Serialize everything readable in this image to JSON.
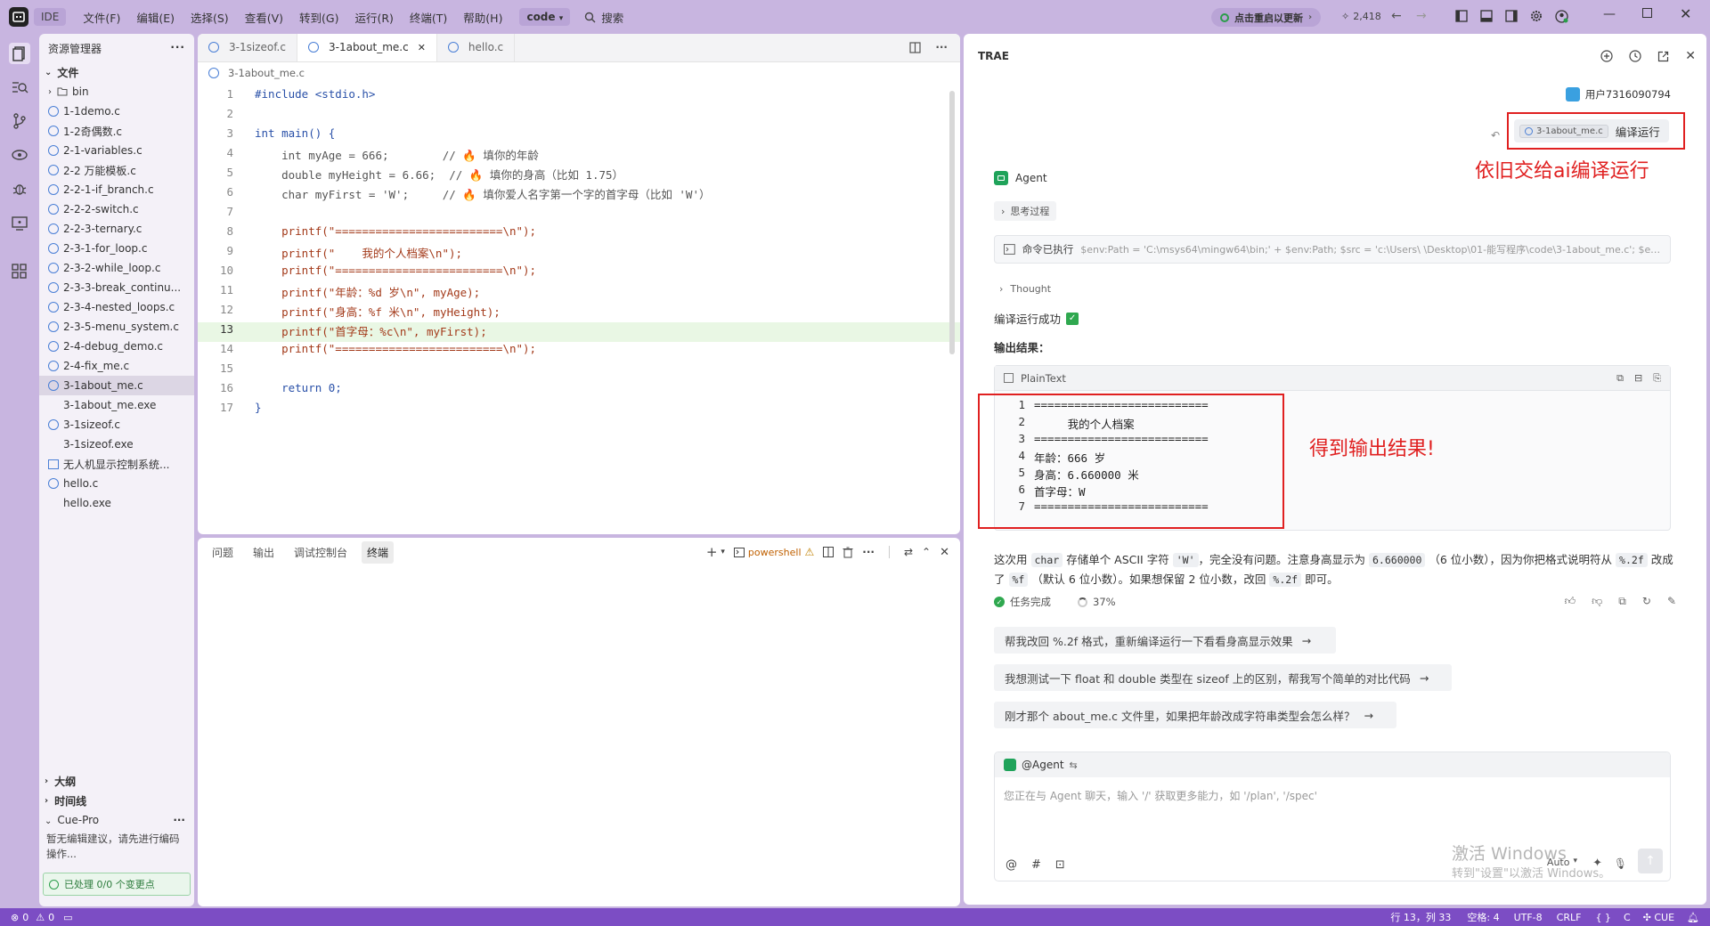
{
  "titlebar": {
    "ide_label": "IDE",
    "menus": [
      "文件(F)",
      "编辑(E)",
      "选择(S)",
      "查看(V)",
      "转到(G)",
      "运行(R)",
      "终端(T)",
      "帮助(H)"
    ],
    "project": "code",
    "search_label": "搜索",
    "update_label": "点击重启以更新",
    "count": "2,418"
  },
  "explorer": {
    "title": "资源管理器",
    "root": "文件",
    "folder": "bin",
    "files": [
      "1-1demo.c",
      "1-2奇偶数.c",
      "2-1-variables.c",
      "2-2 万能模板.c",
      "2-2-1-if_branch.c",
      "2-2-2-switch.c",
      "2-2-3-ternary.c",
      "2-3-1-for_loop.c",
      "2-3-2-while_loop.c",
      "2-3-3-break_continu...",
      "2-3-4-nested_loops.c",
      "2-3-5-menu_system.c",
      "2-4-debug_demo.c",
      "2-4-fix_me.c",
      "3-1about_me.c",
      "3-1about_me.exe",
      "3-1sizeof.c",
      "3-1sizeof.exe",
      "无人机显示控制系统...",
      "hello.c",
      "hello.exe"
    ],
    "outline": "大纲",
    "timeline": "时间线",
    "cue_title": "Cue-Pro",
    "cue_text": "暂无编辑建议，请先进行编码操作...",
    "cue_status": "已处理 0/0 个变更点"
  },
  "editor": {
    "tabs": [
      "3-1sizeof.c",
      "3-1about_me.c",
      "hello.c"
    ],
    "breadcrumb": "3-1about_me.c",
    "lines": [
      "#include <stdio.h>",
      "",
      "int main() {",
      "    int myAge = 666;        // 🔥 填你的年龄",
      "    double myHeight = 6.66;  // 🔥 填你的身高（比如 1.75）",
      "    char myFirst = 'W';     // 🔥 填你爱人名字第一个字的首字母（比如 'W'）",
      "",
      "    printf(\"=========================\\n\");",
      "    printf(\"    我的个人档案\\n\");",
      "    printf(\"=========================\\n\");",
      "    printf(\"年龄：%d 岁\\n\", myAge);",
      "    printf(\"身高：%f 米\\n\", myHeight);",
      "    printf(\"首字母：%c\\n\", myFirst);",
      "    printf(\"=========================\\n\");",
      "",
      "    return 0;",
      "}"
    ],
    "line_numbers": [
      "1",
      "2",
      "3",
      "4",
      "5",
      "6",
      "7",
      "8",
      "9",
      "10",
      "11",
      "12",
      "13",
      "14",
      "15",
      "16",
      "17"
    ]
  },
  "terminal": {
    "tabs": [
      "问题",
      "输出",
      "调试控制台",
      "终端"
    ],
    "shell": "powershell"
  },
  "chat": {
    "title": "TRAE",
    "user": "用户7316090794",
    "file_chip": "3-1about_me.c",
    "user_msg": "编译运行",
    "note1": "依旧交给ai编译运行",
    "agent": "Agent",
    "thinking": "思考过程",
    "command_prefix": "命令已执行",
    "command": "$env:Path = 'C:\\msys64\\mingw64\\bin;' + $env:Path; $src = 'c:\\Users\\      \\Desktop\\01-能写程序\\code\\3-1about_me.c'; $exe...",
    "thought": "Thought",
    "success": "编译运行成功",
    "output_label": "输出结果：",
    "code_lang": "PlainText",
    "output_lines": [
      "==========================",
      "     我的个人档案",
      "==========================",
      "年龄：666 岁",
      "身高：6.660000 米",
      "首字母：W",
      "=========================="
    ],
    "output_nums": [
      "1",
      "2",
      "3",
      "4",
      "5",
      "6",
      "7"
    ],
    "note2": "得到输出结果!",
    "explain_1": "这次用",
    "explain_c1": "char",
    "explain_2": "存储单个 ASCII 字符",
    "explain_c2": "'W'",
    "explain_3": "，完全没有问题。注意身高显示为",
    "explain_c3": "6.660000",
    "explain_4": "（6 位小数），因为你把格式说明符从",
    "explain_c4": "%.2f",
    "explain_5": "改成了",
    "explain_c5": "%f",
    "explain_6": "（默认 6 位小数）。如果想保留 2 位小数，改回",
    "explain_c6": "%.2f",
    "explain_7": "即可。",
    "task_done": "任务完成",
    "progress": "37%",
    "suggestions": [
      "帮我改回 %.2f 格式，重新编译运行一下看看身高显示效果",
      "我想测试一下 float 和 double 类型在 sizeof 上的区别，帮我写个简单的对比代码",
      "刚才那个 about_me.c 文件里，如果把年龄改成字符串类型会怎么样？"
    ],
    "agent_mention": "@Agent",
    "input_placeholder": "您正在与 Agent 聊天，输入 '/' 获取更多能力，如 '/plan', '/spec'",
    "mode": "Auto",
    "watermark1": "激活 Windows",
    "watermark2": "转到\"设置\"以激活 Windows。"
  },
  "status": {
    "errors": "0",
    "warnings": "0",
    "position": "行 13，列 33",
    "spaces": "空格: 4",
    "encoding": "UTF-8",
    "eol": "CRLF",
    "lang": "C",
    "cue": "CUE"
  }
}
